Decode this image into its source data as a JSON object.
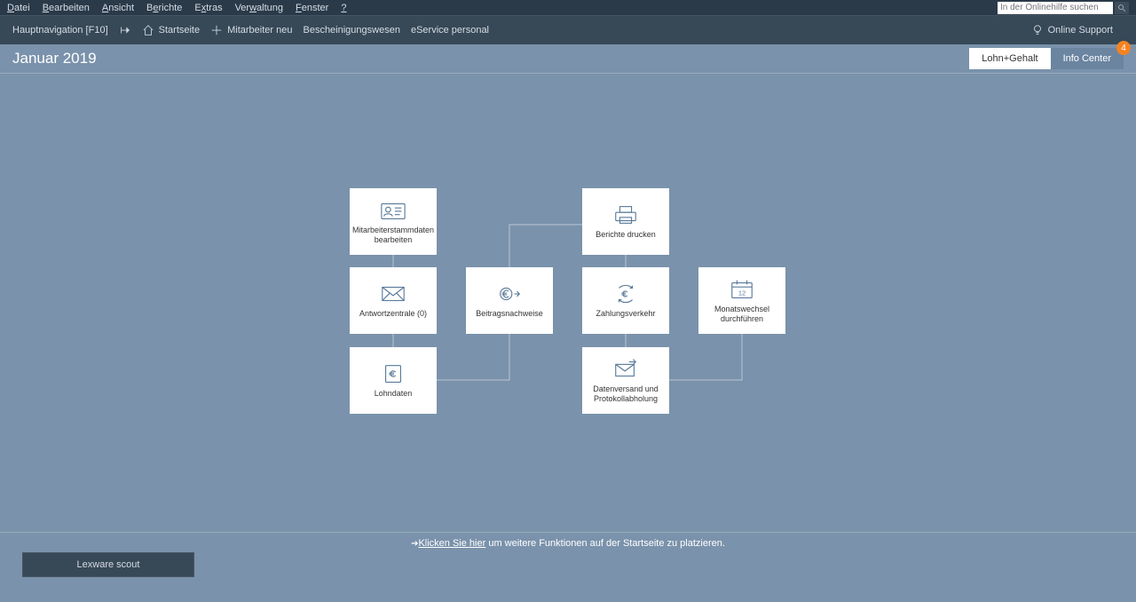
{
  "menubar": {
    "items": [
      "Datei",
      "Bearbeiten",
      "Ansicht",
      "Berichte",
      "Extras",
      "Verwaltung",
      "Fenster",
      "?"
    ],
    "accelLetters": [
      "D",
      "B",
      "A",
      "B",
      "E",
      "",
      "F",
      ""
    ],
    "search_placeholder": "In der Onlinehilfe suchen"
  },
  "toolbar": {
    "nav_label": "Hauptnavigation [F10]",
    "pin_icon": "pin-icon",
    "home_label": "Startseite",
    "add_label": "Mitarbeiter neu",
    "cert_label": "Bescheinigungswesen",
    "eservice_label": "eService personal",
    "support_label": "Online Support"
  },
  "header": {
    "title": "Januar 2019",
    "tabs": [
      {
        "label": "Lohn+Gehalt",
        "active": true
      },
      {
        "label": "Info Center",
        "active": false
      }
    ],
    "badge": "4"
  },
  "cards": {
    "c1": "Mitarbeiterstammdaten bearbeiten",
    "c2": "Berichte drucken",
    "c3": "Antwortzentrale (0)",
    "c4": "Beitragsnachweise",
    "c5": "Zahlungsverkehr",
    "c6": "Monatswechsel durchführen",
    "c7": "Lohndaten",
    "c8": "Datenversand und Protokollabholung"
  },
  "footer": {
    "link_text": "Klicken Sie hier",
    "rest_text": " um weitere Funktionen auf der Startseite zu platzieren."
  },
  "scout_btn": "Lexware scout"
}
